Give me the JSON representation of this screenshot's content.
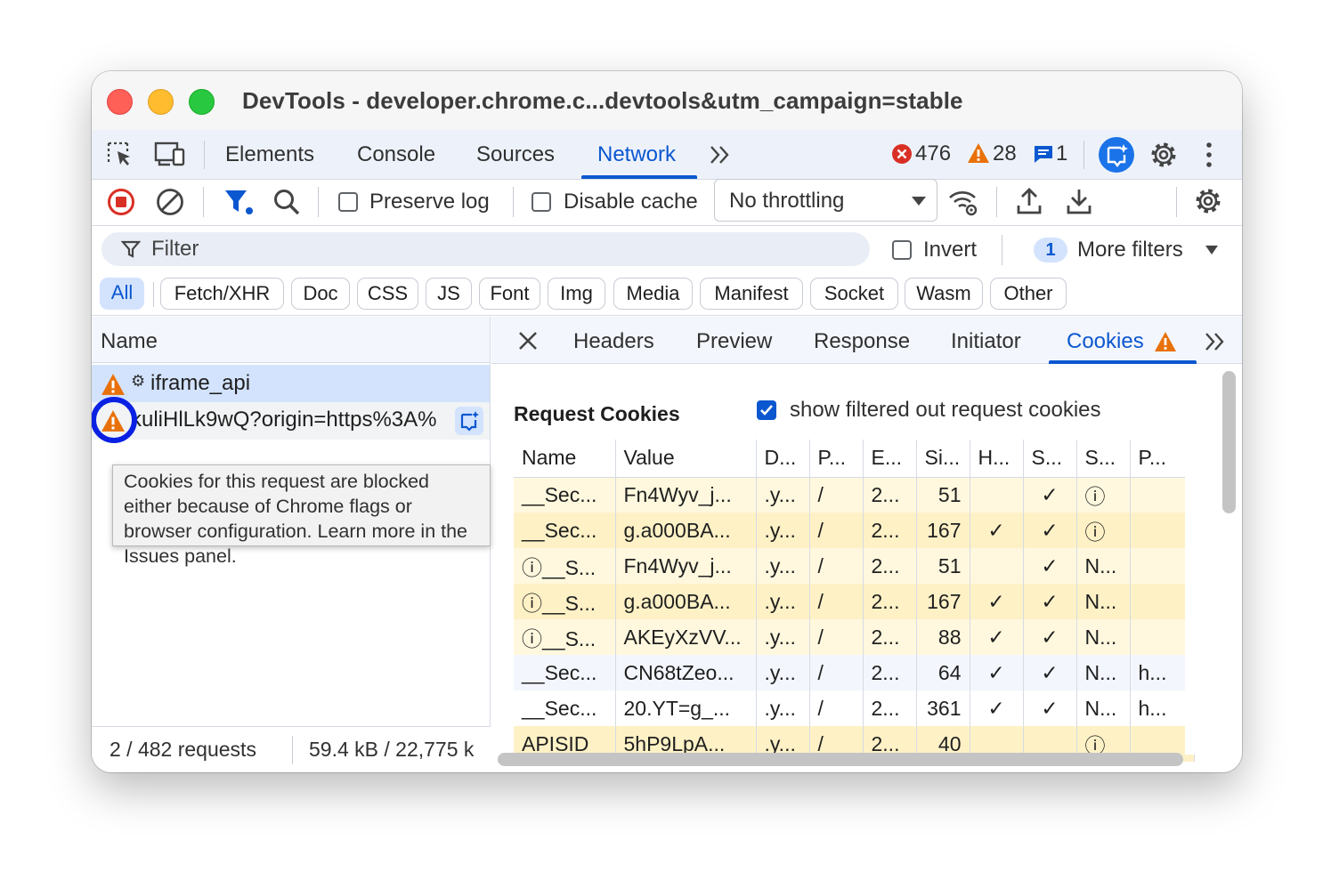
{
  "window": {
    "title": "DevTools - developer.chrome.c...devtools&utm_campaign=stable"
  },
  "main_tabs": [
    "Elements",
    "Console",
    "Sources",
    "Network"
  ],
  "active_tab": "Network",
  "counts": {
    "errors": "476",
    "warnings": "28",
    "messages": "1"
  },
  "toolbar": {
    "preserve_log": "Preserve log",
    "disable_cache": "Disable cache",
    "throttling": "No throttling"
  },
  "filter": {
    "placeholder": "Filter",
    "invert": "Invert",
    "more_filters_count": "1",
    "more_filters": "More filters"
  },
  "type_filters": [
    "All",
    "Fetch/XHR",
    "Doc",
    "CSS",
    "JS",
    "Font",
    "Img",
    "Media",
    "Manifest",
    "Socket",
    "Wasm",
    "Other"
  ],
  "requests": {
    "column": "Name",
    "rows": [
      {
        "name": "iframe_api"
      },
      {
        "name": "kuliHlLk9wQ?origin=https%3A%"
      }
    ],
    "status_requests": "2 / 482 requests",
    "status_size": "59.4 kB / 22,775 k"
  },
  "tooltip": "Cookies for this request are blocked either because of Chrome flags or browser configuration. Learn more in the Issues panel.",
  "detail_tabs": [
    "Headers",
    "Preview",
    "Response",
    "Initiator",
    "Cookies"
  ],
  "active_detail_tab": "Cookies",
  "cookies": {
    "section_title": "Request Cookies",
    "show_filtered": "show filtered out request cookies",
    "columns": [
      "Name",
      "Value",
      "D...",
      "P...",
      "E...",
      "Si...",
      "H...",
      "S...",
      "S...",
      "P..."
    ],
    "rows": [
      [
        "__Sec...",
        "Fn4Wyv_j...",
        ".y...",
        "/",
        "2...",
        "51",
        "",
        "✓",
        "ⓘ",
        ""
      ],
      [
        "__Sec...",
        "g.a000BA...",
        ".y...",
        "/",
        "2...",
        "167",
        "✓",
        "✓",
        "ⓘ",
        ""
      ],
      [
        "ⓘ__S...",
        "Fn4Wyv_j...",
        ".y...",
        "/",
        "2...",
        "51",
        "",
        "✓",
        "N...",
        ""
      ],
      [
        "ⓘ__S...",
        "g.a000BA...",
        ".y...",
        "/",
        "2...",
        "167",
        "✓",
        "✓",
        "N...",
        ""
      ],
      [
        "ⓘ__S...",
        "AKEyXzVV...",
        ".y...",
        "/",
        "2...",
        "88",
        "✓",
        "✓",
        "N...",
        ""
      ],
      [
        "__Sec...",
        "CN68tZeo...",
        ".y...",
        "/",
        "2...",
        "64",
        "✓",
        "✓",
        "N...",
        "h..."
      ],
      [
        "__Sec...",
        "20.YT=g_...",
        ".y...",
        "/",
        "2...",
        "361",
        "✓",
        "✓",
        "N...",
        "h..."
      ],
      [
        "APISID",
        "5hP9LpA...",
        ".y...",
        "/",
        "2...",
        "40",
        "",
        "",
        "ⓘ",
        ""
      ]
    ]
  },
  "colors": {
    "accent": "#0b57d0",
    "warning": "#e8710a",
    "error": "#d93025",
    "highlight_ring": "#0a21e3"
  }
}
